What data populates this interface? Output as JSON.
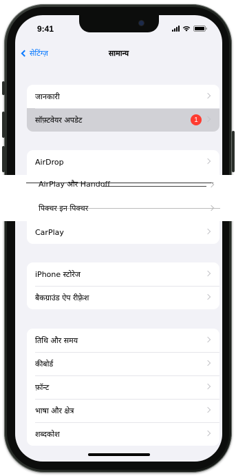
{
  "status_bar": {
    "time": "9:41"
  },
  "nav": {
    "back_label": "सेटिंग्ज़",
    "title": "सामान्य"
  },
  "group1": {
    "items": [
      {
        "label": "जानकारी"
      },
      {
        "label": "सॉफ़्टवेयर अपडेट",
        "badge": "1"
      }
    ]
  },
  "group2": {
    "items": [
      {
        "label": "AirDrop"
      },
      {
        "label": "AirPlay और Handoff"
      },
      {
        "label": "पिक्चर इन पिक्चर"
      },
      {
        "label": "CarPlay"
      }
    ]
  },
  "group3": {
    "items": [
      {
        "label": "iPhone स्टोरेज"
      },
      {
        "label": "बैकग्राउंड ऐप रीफ़्रेश"
      }
    ]
  },
  "group4": {
    "items": [
      {
        "label": "तिथि और समय"
      },
      {
        "label": "कीबोर्ड"
      },
      {
        "label": "फ़ॉन्ट"
      },
      {
        "label": "भाषा और क्षेत्र"
      },
      {
        "label": "शब्दकोश"
      }
    ]
  },
  "colors": {
    "accent": "#0a7aff",
    "badge": "#ff3b30",
    "background": "#f2f2f7"
  }
}
